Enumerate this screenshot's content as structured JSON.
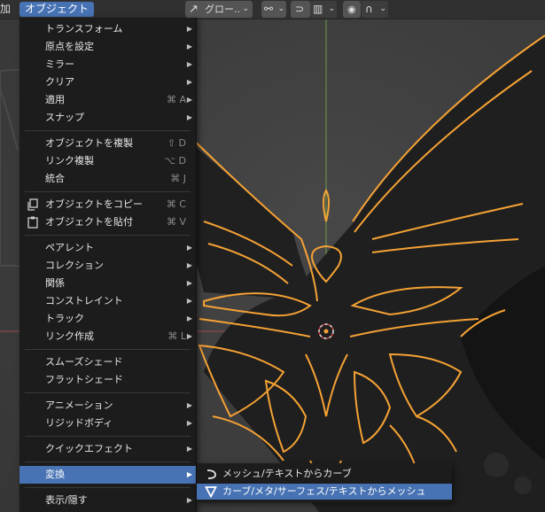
{
  "header": {
    "add_menu_label": "加",
    "object_menu_label": "オブジェクト",
    "orientation_label": "グロー..",
    "orientation_icon": "transform-orientation-icon",
    "pivot_icon": "pivot-point-icon",
    "snap_icon": "snap-icon",
    "proportional_icon": "proportional-edit-icon",
    "falloff_icon": "falloff-curve-icon"
  },
  "menu": {
    "items": [
      {
        "label": "トランスフォーム",
        "shortcut": "",
        "submenu": true
      },
      {
        "label": "原点を設定",
        "shortcut": "",
        "submenu": true
      },
      {
        "label": "ミラー",
        "shortcut": "",
        "submenu": true
      },
      {
        "label": "クリア",
        "shortcut": "",
        "submenu": true
      },
      {
        "label": "適用",
        "shortcut": "⌘ A",
        "submenu": true
      },
      {
        "label": "スナップ",
        "shortcut": "",
        "submenu": true
      },
      {
        "label": "オブジェクトを複製",
        "shortcut": "⇧ D",
        "submenu": false
      },
      {
        "label": "リンク複製",
        "shortcut": "⌥ D",
        "submenu": false
      },
      {
        "label": "統合",
        "shortcut": "⌘ J",
        "submenu": false
      },
      {
        "label": "オブジェクトをコピー",
        "shortcut": "⌘ C",
        "submenu": false
      },
      {
        "label": "オブジェクトを貼付",
        "shortcut": "⌘ V",
        "submenu": false
      },
      {
        "label": "ペアレント",
        "shortcut": "",
        "submenu": true
      },
      {
        "label": "コレクション",
        "shortcut": "",
        "submenu": true
      },
      {
        "label": "関係",
        "shortcut": "",
        "submenu": true
      },
      {
        "label": "コンストレイント",
        "shortcut": "",
        "submenu": true
      },
      {
        "label": "トラック",
        "shortcut": "",
        "submenu": true
      },
      {
        "label": "リンク作成",
        "shortcut": "⌘ L",
        "submenu": true
      },
      {
        "label": "スムーズシェード",
        "shortcut": "",
        "submenu": false
      },
      {
        "label": "フラットシェード",
        "shortcut": "",
        "submenu": false
      },
      {
        "label": "アニメーション",
        "shortcut": "",
        "submenu": true
      },
      {
        "label": "リジッドボディ",
        "shortcut": "",
        "submenu": true
      },
      {
        "label": "クイックエフェクト",
        "shortcut": "",
        "submenu": true
      },
      {
        "label": "変換",
        "shortcut": "",
        "submenu": true,
        "active": true
      },
      {
        "label": "表示/隠す",
        "shortcut": "",
        "submenu": true
      }
    ]
  },
  "submenu": {
    "items": [
      {
        "label": "メッシュ/テキストからカーブ",
        "icon": "curve-icon"
      },
      {
        "label": "カーブ/メタ/サーフェス/テキストからメッシュ",
        "icon": "mesh-triangle-icon",
        "highlighted": true
      }
    ]
  },
  "colors": {
    "accent": "#4772b3",
    "selection_outline": "#f5a235",
    "axis_green": "#6e9b4a",
    "axis_red": "#a04a4a"
  }
}
